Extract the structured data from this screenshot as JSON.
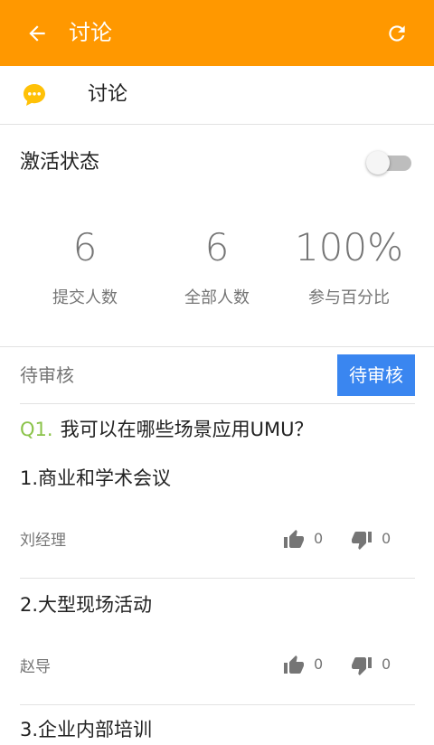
{
  "appbar": {
    "title": "讨论",
    "back_icon": "arrow-left-icon",
    "refresh_icon": "refresh-icon",
    "color": "#ff9800"
  },
  "section": {
    "icon": "chat-bubble-icon",
    "label": "讨论",
    "icon_color": "#ffc107"
  },
  "activation": {
    "label": "激活状态",
    "enabled": false
  },
  "stats": [
    {
      "value": "6",
      "caption": "提交人数"
    },
    {
      "value": "6",
      "caption": "全部人数"
    },
    {
      "value": "100%",
      "caption": "参与百分比"
    }
  ],
  "review": {
    "label": "待审核",
    "button_label": "待审核",
    "button_color": "#3a86f0"
  },
  "question": {
    "number": "Q1.",
    "text": "我可以在哪些场景应用UMU？"
  },
  "answers": [
    {
      "title": "1.商业和学术会议",
      "author": "刘经理",
      "likes": "0",
      "dislikes": "0"
    },
    {
      "title": "2.大型现场活动",
      "author": "赵导",
      "likes": "0",
      "dislikes": "0"
    },
    {
      "title": "3.企业内部培训"
    }
  ]
}
